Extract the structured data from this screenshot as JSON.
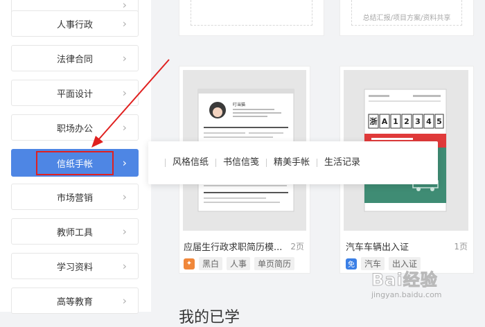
{
  "sidebar": {
    "items": [
      {
        "label": ""
      },
      {
        "label": "人事行政"
      },
      {
        "label": "法律合同"
      },
      {
        "label": "平面设计"
      },
      {
        "label": "职场办公"
      },
      {
        "label": "信纸手帐"
      },
      {
        "label": "市场营销"
      },
      {
        "label": "教师工具"
      },
      {
        "label": "学习资料"
      },
      {
        "label": "高等教育"
      }
    ],
    "active_index": 5
  },
  "top_cards": [
    {
      "caption": ""
    },
    {
      "caption": "总结汇报/项目方案/资料共享"
    }
  ],
  "submenu": {
    "options": [
      "风格信纸",
      "书信信笺",
      "精美手帐",
      "生活记录"
    ]
  },
  "cards": [
    {
      "title": "应届生行政求职简历模...",
      "pages": "2页",
      "badge": "",
      "tags": [
        "黑白",
        "人事",
        "单页简历"
      ],
      "thumb_name": "叮当猫"
    },
    {
      "title": "汽车车辆出入证",
      "pages": "1页",
      "badge": "免",
      "tags": [
        "汽车",
        "出入证"
      ],
      "plate_chars": [
        "浙",
        "A",
        "1",
        "2",
        "3",
        "4",
        "5"
      ]
    }
  ],
  "bottom_heading": "我的已学",
  "watermark": {
    "brand": "Bai经验",
    "url": "jingyan.baidu.com"
  },
  "colors": {
    "accent": "#4e86e4",
    "highlight_box": "#e0201f",
    "arrow": "#e0201f",
    "badge_orange": "#f0873a",
    "badge_blue": "#3a7fe6",
    "plate_red": "#e03a3a",
    "plate_green": "#3f8c74"
  }
}
